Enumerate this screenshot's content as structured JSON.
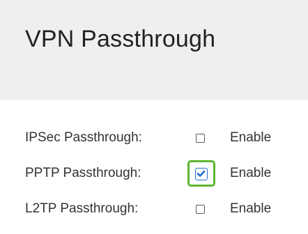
{
  "header": {
    "title": "VPN Passthrough"
  },
  "settings": [
    {
      "label": "IPSec Passthrough:",
      "option_label": "Enable",
      "checked": false
    },
    {
      "label": "PPTP Passthrough:",
      "option_label": "Enable",
      "checked": true,
      "highlighted": true
    },
    {
      "label": "L2TP Passthrough:",
      "option_label": "Enable",
      "checked": false
    }
  ],
  "colors": {
    "header_background": "#efefef",
    "check_accent": "#1d6fd4",
    "highlight": "#5cb531"
  }
}
